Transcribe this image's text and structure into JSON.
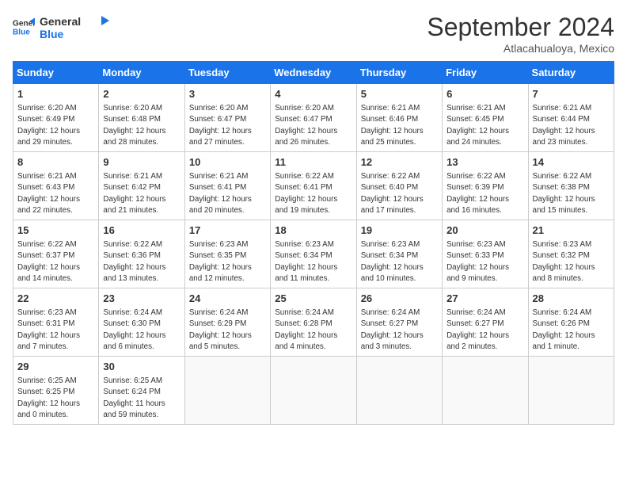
{
  "logo": {
    "line1": "General",
    "line2": "Blue"
  },
  "title": "September 2024",
  "subtitle": "Atlacahualoya, Mexico",
  "days_of_week": [
    "Sunday",
    "Monday",
    "Tuesday",
    "Wednesday",
    "Thursday",
    "Friday",
    "Saturday"
  ],
  "weeks": [
    [
      {
        "day": "1",
        "info": "Sunrise: 6:20 AM\nSunset: 6:49 PM\nDaylight: 12 hours\nand 29 minutes."
      },
      {
        "day": "2",
        "info": "Sunrise: 6:20 AM\nSunset: 6:48 PM\nDaylight: 12 hours\nand 28 minutes."
      },
      {
        "day": "3",
        "info": "Sunrise: 6:20 AM\nSunset: 6:47 PM\nDaylight: 12 hours\nand 27 minutes."
      },
      {
        "day": "4",
        "info": "Sunrise: 6:20 AM\nSunset: 6:47 PM\nDaylight: 12 hours\nand 26 minutes."
      },
      {
        "day": "5",
        "info": "Sunrise: 6:21 AM\nSunset: 6:46 PM\nDaylight: 12 hours\nand 25 minutes."
      },
      {
        "day": "6",
        "info": "Sunrise: 6:21 AM\nSunset: 6:45 PM\nDaylight: 12 hours\nand 24 minutes."
      },
      {
        "day": "7",
        "info": "Sunrise: 6:21 AM\nSunset: 6:44 PM\nDaylight: 12 hours\nand 23 minutes."
      }
    ],
    [
      {
        "day": "8",
        "info": "Sunrise: 6:21 AM\nSunset: 6:43 PM\nDaylight: 12 hours\nand 22 minutes."
      },
      {
        "day": "9",
        "info": "Sunrise: 6:21 AM\nSunset: 6:42 PM\nDaylight: 12 hours\nand 21 minutes."
      },
      {
        "day": "10",
        "info": "Sunrise: 6:21 AM\nSunset: 6:41 PM\nDaylight: 12 hours\nand 20 minutes."
      },
      {
        "day": "11",
        "info": "Sunrise: 6:22 AM\nSunset: 6:41 PM\nDaylight: 12 hours\nand 19 minutes."
      },
      {
        "day": "12",
        "info": "Sunrise: 6:22 AM\nSunset: 6:40 PM\nDaylight: 12 hours\nand 17 minutes."
      },
      {
        "day": "13",
        "info": "Sunrise: 6:22 AM\nSunset: 6:39 PM\nDaylight: 12 hours\nand 16 minutes."
      },
      {
        "day": "14",
        "info": "Sunrise: 6:22 AM\nSunset: 6:38 PM\nDaylight: 12 hours\nand 15 minutes."
      }
    ],
    [
      {
        "day": "15",
        "info": "Sunrise: 6:22 AM\nSunset: 6:37 PM\nDaylight: 12 hours\nand 14 minutes."
      },
      {
        "day": "16",
        "info": "Sunrise: 6:22 AM\nSunset: 6:36 PM\nDaylight: 12 hours\nand 13 minutes."
      },
      {
        "day": "17",
        "info": "Sunrise: 6:23 AM\nSunset: 6:35 PM\nDaylight: 12 hours\nand 12 minutes."
      },
      {
        "day": "18",
        "info": "Sunrise: 6:23 AM\nSunset: 6:34 PM\nDaylight: 12 hours\nand 11 minutes."
      },
      {
        "day": "19",
        "info": "Sunrise: 6:23 AM\nSunset: 6:34 PM\nDaylight: 12 hours\nand 10 minutes."
      },
      {
        "day": "20",
        "info": "Sunrise: 6:23 AM\nSunset: 6:33 PM\nDaylight: 12 hours\nand 9 minutes."
      },
      {
        "day": "21",
        "info": "Sunrise: 6:23 AM\nSunset: 6:32 PM\nDaylight: 12 hours\nand 8 minutes."
      }
    ],
    [
      {
        "day": "22",
        "info": "Sunrise: 6:23 AM\nSunset: 6:31 PM\nDaylight: 12 hours\nand 7 minutes."
      },
      {
        "day": "23",
        "info": "Sunrise: 6:24 AM\nSunset: 6:30 PM\nDaylight: 12 hours\nand 6 minutes."
      },
      {
        "day": "24",
        "info": "Sunrise: 6:24 AM\nSunset: 6:29 PM\nDaylight: 12 hours\nand 5 minutes."
      },
      {
        "day": "25",
        "info": "Sunrise: 6:24 AM\nSunset: 6:28 PM\nDaylight: 12 hours\nand 4 minutes."
      },
      {
        "day": "26",
        "info": "Sunrise: 6:24 AM\nSunset: 6:27 PM\nDaylight: 12 hours\nand 3 minutes."
      },
      {
        "day": "27",
        "info": "Sunrise: 6:24 AM\nSunset: 6:27 PM\nDaylight: 12 hours\nand 2 minutes."
      },
      {
        "day": "28",
        "info": "Sunrise: 6:24 AM\nSunset: 6:26 PM\nDaylight: 12 hours\nand 1 minute."
      }
    ],
    [
      {
        "day": "29",
        "info": "Sunrise: 6:25 AM\nSunset: 6:25 PM\nDaylight: 12 hours\nand 0 minutes."
      },
      {
        "day": "30",
        "info": "Sunrise: 6:25 AM\nSunset: 6:24 PM\nDaylight: 11 hours\nand 59 minutes."
      },
      {
        "day": "",
        "info": ""
      },
      {
        "day": "",
        "info": ""
      },
      {
        "day": "",
        "info": ""
      },
      {
        "day": "",
        "info": ""
      },
      {
        "day": "",
        "info": ""
      }
    ]
  ]
}
